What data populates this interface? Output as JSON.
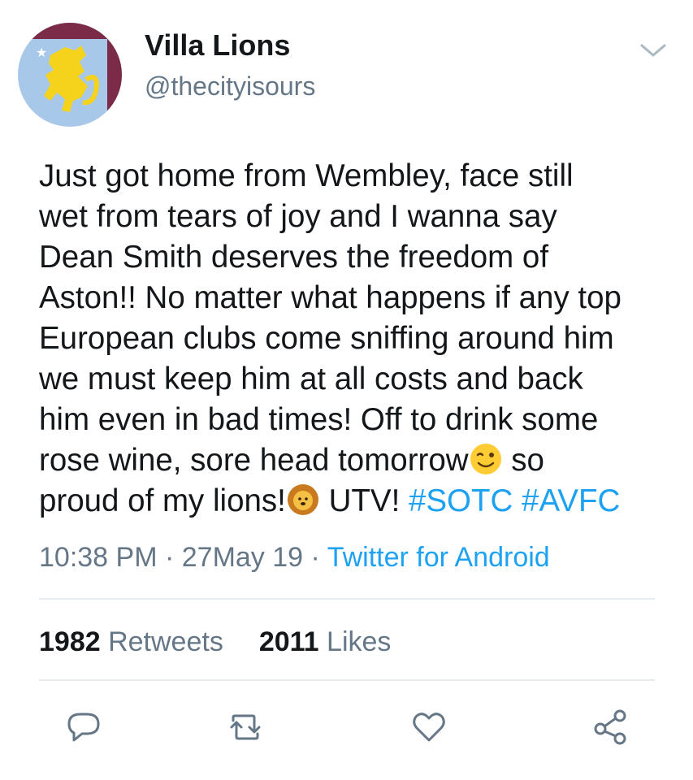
{
  "tweet": {
    "display_name": "Villa Lions",
    "handle": "@thecityisours",
    "text_lines": [
      "Just got home from Wembley, face still",
      "wet from tears of joy and I wanna say",
      "Dean Smith deserves the freedom of",
      "Aston!! No matter what happens if any top",
      "European clubs come sniffing around him",
      "we must keep him at all costs and back",
      "him even in bad times! Off to drink some"
    ],
    "line8_text": "rose wine, sore head tomorrow",
    "line8_after_emoji": " so",
    "line9_text": "proud of my lions!",
    "line9_after_emoji": " UTV! ",
    "hashtags": [
      "#SOTC",
      "#AVFC"
    ],
    "emojis": [
      "wink-emoji",
      "lion-emoji"
    ],
    "time": "10:38 PM",
    "date": "27May 19",
    "separator": " · ",
    "source": "Twitter for Android",
    "retweets_count": "1982",
    "retweets_label": "Retweets",
    "likes_count": "2011",
    "likes_label": "Likes"
  },
  "actions": [
    "reply-icon",
    "retweet-icon",
    "like-icon",
    "share-icon"
  ],
  "colors": {
    "link": "#1da1f2",
    "secondary_text": "#657786",
    "icon": "#657786",
    "divider": "#e6ecf0",
    "avatar_bg": "#a8c8ea",
    "avatar_claret": "#7b2b48",
    "lion_gold": "#f5d31c"
  }
}
